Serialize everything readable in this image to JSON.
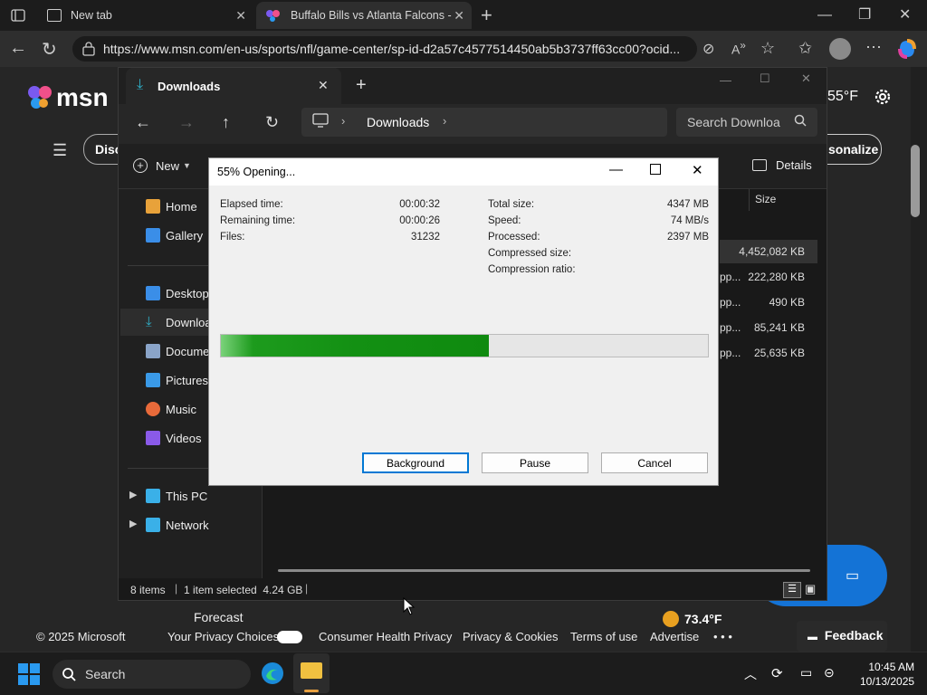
{
  "browser": {
    "tabs": [
      {
        "label": "New tab"
      },
      {
        "label": "Buffalo Bills vs Atlanta Falcons - G"
      }
    ],
    "url": "https://www.msn.com/en-us/sports/nfl/game-center/sp-id-d2a57c4577514450ab5b3737ff63cc00?ocid..."
  },
  "msn": {
    "logo": "msn",
    "temp": "55°F",
    "discover_label": "Disco",
    "personalize_label": "sonalize",
    "forecast_label": "Forecast",
    "forecast_temp": "73.4°F",
    "footer": {
      "copyright": "© 2025 Microsoft",
      "privacy_choices": "Your Privacy Choices",
      "consumer_health": "Consumer Health Privacy",
      "privacy_cookies": "Privacy & Cookies",
      "terms": "Terms of use",
      "advertise": "Advertise",
      "more": "• • •",
      "feedback": "Feedback"
    }
  },
  "explorer": {
    "tab_title": "Downloads",
    "breadcrumb": "Downloads",
    "search_placeholder": "Search Downloa",
    "new_label": "New",
    "details_label": "Details",
    "size_header": "Size",
    "sidebar": [
      {
        "label": "Home",
        "icon": "home-icon",
        "color": "#e8a23a"
      },
      {
        "label": "Gallery",
        "icon": "gallery-icon",
        "color": "#3a8ee8"
      },
      {
        "label": "Desktop",
        "icon": "desktop-icon",
        "color": "#3a8ee8"
      },
      {
        "label": "Downloa",
        "icon": "download-icon",
        "color": "#2fb0c8"
      },
      {
        "label": "Docume",
        "icon": "documents-icon",
        "color": "#8aa4c8"
      },
      {
        "label": "Pictures",
        "icon": "pictures-icon",
        "color": "#3a9ae8"
      },
      {
        "label": "Music",
        "icon": "music-icon",
        "color": "#e86a3a"
      },
      {
        "label": "Videos",
        "icon": "videos-icon",
        "color": "#8a5ae8"
      },
      {
        "label": "This PC",
        "icon": "pc-icon",
        "color": "#3ab0e8"
      },
      {
        "label": "Network",
        "icon": "network-icon",
        "color": "#3ab0e8"
      }
    ],
    "files": [
      {
        "type": "",
        "size": "4,452,082 KB"
      },
      {
        "type": "pp...",
        "size": "222,280 KB"
      },
      {
        "type": "pp...",
        "size": "490 KB"
      },
      {
        "type": "pp...",
        "size": "85,241 KB"
      },
      {
        "type": "pp...",
        "size": "25,635 KB"
      }
    ],
    "status": {
      "items": "8 items",
      "selected": "1 item selected  4.24 GB"
    }
  },
  "dialog": {
    "title": "55% Opening...",
    "progress_fraction": 0.55,
    "left_stats": [
      {
        "label": "Elapsed time:",
        "value": "00:00:32"
      },
      {
        "label": "Remaining time:",
        "value": "00:00:26"
      },
      {
        "label": "Files:",
        "value": "31232"
      }
    ],
    "right_stats": [
      {
        "label": "Total size:",
        "value": "4347 MB"
      },
      {
        "label": "Speed:",
        "value": "74 MB/s"
      },
      {
        "label": "Processed:",
        "value": "2397 MB"
      },
      {
        "label": "Compressed size:",
        "value": ""
      },
      {
        "label": "Compression ratio:",
        "value": ""
      }
    ],
    "buttons": {
      "background": "Background",
      "pause": "Pause",
      "cancel": "Cancel"
    }
  },
  "taskbar": {
    "search_label": "Search",
    "time": "10:45 AM",
    "date": "10/13/2025"
  },
  "colors": {
    "progress": "#139013",
    "accent": "#0078d4",
    "msn_blue": "#1473d6"
  }
}
